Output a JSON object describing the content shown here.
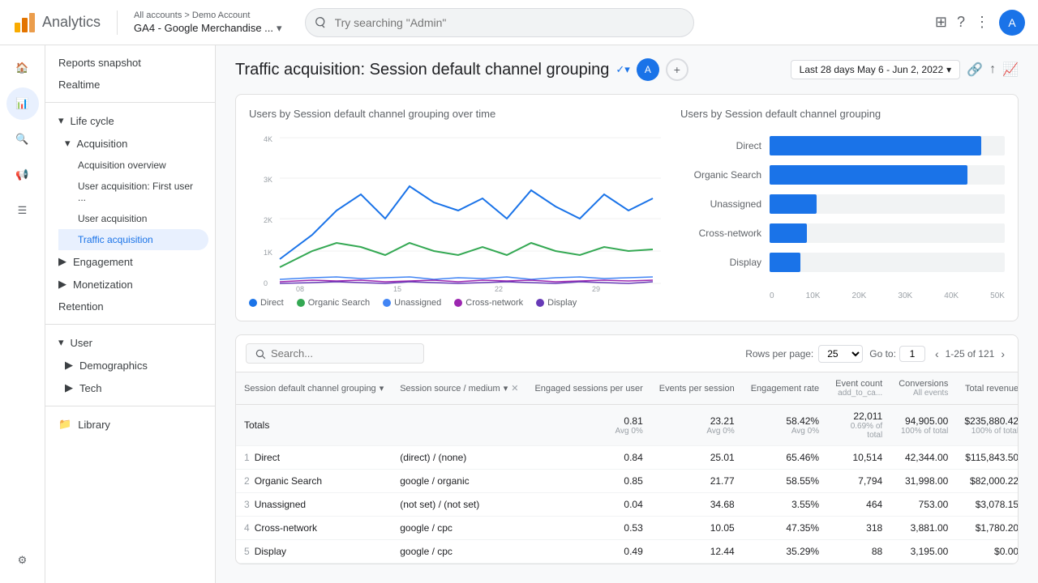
{
  "topbar": {
    "app_name": "Analytics",
    "account_link": "All accounts > Demo Account",
    "property_name": "GA4 - Google Merchandise ...",
    "search_placeholder": "Try searching \"Admin\""
  },
  "sidebar": {
    "snapshot_label": "Reports snapshot",
    "realtime_label": "Realtime",
    "lifecycle_label": "Life cycle",
    "acquisition_label": "Acquisition",
    "acquisition_overview_label": "Acquisition overview",
    "user_acquisition_first_label": "User acquisition: First user ...",
    "user_acquisition_label": "User acquisition",
    "traffic_acquisition_label": "Traffic acquisition",
    "engagement_label": "Engagement",
    "monetization_label": "Monetization",
    "retention_label": "Retention",
    "user_label": "User",
    "demographics_label": "Demographics",
    "tech_label": "Tech",
    "library_label": "Library"
  },
  "page": {
    "title": "Traffic acquisition: Session default channel grouping",
    "date_range": "Last 28 days  May 6 - Jun 2, 2022",
    "user_initial": "A"
  },
  "left_chart": {
    "title": "Users by Session default channel grouping over time",
    "y_labels": [
      "4K",
      "3K",
      "2K",
      "1K",
      "0"
    ],
    "x_labels": [
      "08\nMay",
      "15",
      "22",
      "29"
    ],
    "legend": [
      {
        "label": "Direct",
        "color": "#1a73e8"
      },
      {
        "label": "Organic Search",
        "color": "#34a853"
      },
      {
        "label": "Unassigned",
        "color": "#4285f4"
      },
      {
        "label": "Cross-network",
        "color": "#9c27b0"
      },
      {
        "label": "Display",
        "color": "#673ab7"
      }
    ]
  },
  "right_chart": {
    "title": "Users by Session default channel grouping",
    "bars": [
      {
        "label": "Direct",
        "value": 45000,
        "max": 50000,
        "pct": 90
      },
      {
        "label": "Organic Search",
        "value": 42000,
        "max": 50000,
        "pct": 84
      },
      {
        "label": "Unassigned",
        "value": 10000,
        "max": 50000,
        "pct": 20
      },
      {
        "label": "Cross-network",
        "value": 8000,
        "max": 50000,
        "pct": 16
      },
      {
        "label": "Display",
        "value": 6500,
        "max": 50000,
        "pct": 13
      }
    ],
    "axis_labels": [
      "0",
      "10K",
      "20K",
      "30K",
      "40K",
      "50K"
    ]
  },
  "table": {
    "search_placeholder": "Search...",
    "rows_per_page_label": "Rows per page:",
    "rows_per_page_value": "25",
    "goto_label": "Go to:",
    "goto_value": "1",
    "pagination_text": "1-25 of 121",
    "col_session_default": "Session default channel\ngrouping",
    "col_session_source": "Session source / medium",
    "col_engaged_sessions": "Engaged sessions\nper user",
    "col_avg_0": "Avg 0%",
    "col_events_per_session": "Events per session",
    "col_engagement_rate": "Engagement rate",
    "col_event_count": "Event count",
    "col_event_count_sub": "add_to_ca...",
    "col_conversions": "Conversions",
    "col_conversions_sub": "All events",
    "col_total_revenue": "Total revenue",
    "totals_label": "Totals",
    "totals_engaged": "0.81",
    "totals_engaged_sub": "Avg 0%",
    "totals_events_per_session": "23.21",
    "totals_events_sub": "Avg 0%",
    "totals_engagement_rate": "58.42%",
    "totals_engagement_sub": "Avg 0%",
    "totals_event_count": "22,011",
    "totals_event_count_sub": "0.69% of total",
    "totals_conversions": "94,905.00",
    "totals_conversions_sub": "100% of total",
    "totals_revenue": "$235,880.42",
    "totals_revenue_sub": "100% of total",
    "rows": [
      {
        "rank": "1",
        "channel": "Direct",
        "source": "(direct) / (none)",
        "engaged": "0.84",
        "events_per_session": "25.01",
        "engagement_rate": "65.46%",
        "event_count": "10,514",
        "conversions": "42,344.00",
        "revenue": "$115,843.50"
      },
      {
        "rank": "2",
        "channel": "Organic Search",
        "source": "google / organic",
        "engaged": "0.85",
        "events_per_session": "21.77",
        "engagement_rate": "58.55%",
        "event_count": "7,794",
        "conversions": "31,998.00",
        "revenue": "$82,000.22"
      },
      {
        "rank": "3",
        "channel": "Unassigned",
        "source": "(not set) / (not set)",
        "engaged": "0.04",
        "events_per_session": "34.68",
        "engagement_rate": "3.55%",
        "event_count": "464",
        "conversions": "753.00",
        "revenue": "$3,078.15"
      },
      {
        "rank": "4",
        "channel": "Cross-network",
        "source": "google / cpc",
        "engaged": "0.53",
        "events_per_session": "10.05",
        "engagement_rate": "47.35%",
        "event_count": "318",
        "conversions": "3,881.00",
        "revenue": "$1,780.20"
      },
      {
        "rank": "5",
        "channel": "Display",
        "source": "google / cpc",
        "engaged": "0.49",
        "events_per_session": "12.44",
        "engagement_rate": "35.29%",
        "event_count": "88",
        "conversions": "3,195.00",
        "revenue": "$0.00"
      }
    ]
  }
}
